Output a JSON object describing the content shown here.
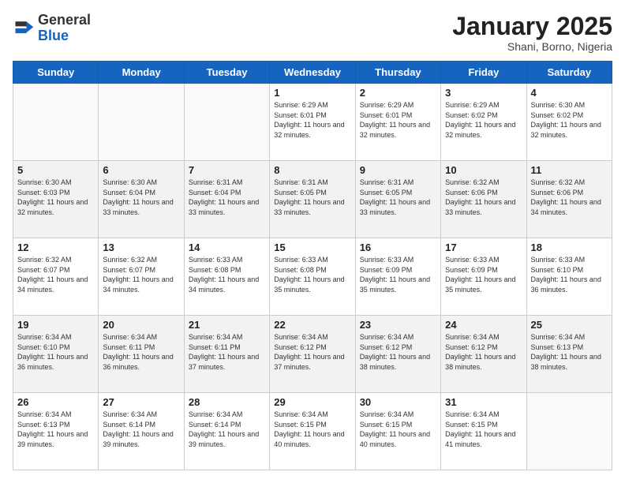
{
  "header": {
    "logo_general": "General",
    "logo_blue": "Blue",
    "month_title": "January 2025",
    "location": "Shani, Borno, Nigeria"
  },
  "days_of_week": [
    "Sunday",
    "Monday",
    "Tuesday",
    "Wednesday",
    "Thursday",
    "Friday",
    "Saturday"
  ],
  "weeks": [
    [
      {
        "day": "",
        "info": ""
      },
      {
        "day": "",
        "info": ""
      },
      {
        "day": "",
        "info": ""
      },
      {
        "day": "1",
        "info": "Sunrise: 6:29 AM\nSunset: 6:01 PM\nDaylight: 11 hours and 32 minutes."
      },
      {
        "day": "2",
        "info": "Sunrise: 6:29 AM\nSunset: 6:01 PM\nDaylight: 11 hours and 32 minutes."
      },
      {
        "day": "3",
        "info": "Sunrise: 6:29 AM\nSunset: 6:02 PM\nDaylight: 11 hours and 32 minutes."
      },
      {
        "day": "4",
        "info": "Sunrise: 6:30 AM\nSunset: 6:02 PM\nDaylight: 11 hours and 32 minutes."
      }
    ],
    [
      {
        "day": "5",
        "info": "Sunrise: 6:30 AM\nSunset: 6:03 PM\nDaylight: 11 hours and 32 minutes."
      },
      {
        "day": "6",
        "info": "Sunrise: 6:30 AM\nSunset: 6:04 PM\nDaylight: 11 hours and 33 minutes."
      },
      {
        "day": "7",
        "info": "Sunrise: 6:31 AM\nSunset: 6:04 PM\nDaylight: 11 hours and 33 minutes."
      },
      {
        "day": "8",
        "info": "Sunrise: 6:31 AM\nSunset: 6:05 PM\nDaylight: 11 hours and 33 minutes."
      },
      {
        "day": "9",
        "info": "Sunrise: 6:31 AM\nSunset: 6:05 PM\nDaylight: 11 hours and 33 minutes."
      },
      {
        "day": "10",
        "info": "Sunrise: 6:32 AM\nSunset: 6:06 PM\nDaylight: 11 hours and 33 minutes."
      },
      {
        "day": "11",
        "info": "Sunrise: 6:32 AM\nSunset: 6:06 PM\nDaylight: 11 hours and 34 minutes."
      }
    ],
    [
      {
        "day": "12",
        "info": "Sunrise: 6:32 AM\nSunset: 6:07 PM\nDaylight: 11 hours and 34 minutes."
      },
      {
        "day": "13",
        "info": "Sunrise: 6:32 AM\nSunset: 6:07 PM\nDaylight: 11 hours and 34 minutes."
      },
      {
        "day": "14",
        "info": "Sunrise: 6:33 AM\nSunset: 6:08 PM\nDaylight: 11 hours and 34 minutes."
      },
      {
        "day": "15",
        "info": "Sunrise: 6:33 AM\nSunset: 6:08 PM\nDaylight: 11 hours and 35 minutes."
      },
      {
        "day": "16",
        "info": "Sunrise: 6:33 AM\nSunset: 6:09 PM\nDaylight: 11 hours and 35 minutes."
      },
      {
        "day": "17",
        "info": "Sunrise: 6:33 AM\nSunset: 6:09 PM\nDaylight: 11 hours and 35 minutes."
      },
      {
        "day": "18",
        "info": "Sunrise: 6:33 AM\nSunset: 6:10 PM\nDaylight: 11 hours and 36 minutes."
      }
    ],
    [
      {
        "day": "19",
        "info": "Sunrise: 6:34 AM\nSunset: 6:10 PM\nDaylight: 11 hours and 36 minutes."
      },
      {
        "day": "20",
        "info": "Sunrise: 6:34 AM\nSunset: 6:11 PM\nDaylight: 11 hours and 36 minutes."
      },
      {
        "day": "21",
        "info": "Sunrise: 6:34 AM\nSunset: 6:11 PM\nDaylight: 11 hours and 37 minutes."
      },
      {
        "day": "22",
        "info": "Sunrise: 6:34 AM\nSunset: 6:12 PM\nDaylight: 11 hours and 37 minutes."
      },
      {
        "day": "23",
        "info": "Sunrise: 6:34 AM\nSunset: 6:12 PM\nDaylight: 11 hours and 38 minutes."
      },
      {
        "day": "24",
        "info": "Sunrise: 6:34 AM\nSunset: 6:12 PM\nDaylight: 11 hours and 38 minutes."
      },
      {
        "day": "25",
        "info": "Sunrise: 6:34 AM\nSunset: 6:13 PM\nDaylight: 11 hours and 38 minutes."
      }
    ],
    [
      {
        "day": "26",
        "info": "Sunrise: 6:34 AM\nSunset: 6:13 PM\nDaylight: 11 hours and 39 minutes."
      },
      {
        "day": "27",
        "info": "Sunrise: 6:34 AM\nSunset: 6:14 PM\nDaylight: 11 hours and 39 minutes."
      },
      {
        "day": "28",
        "info": "Sunrise: 6:34 AM\nSunset: 6:14 PM\nDaylight: 11 hours and 39 minutes."
      },
      {
        "day": "29",
        "info": "Sunrise: 6:34 AM\nSunset: 6:15 PM\nDaylight: 11 hours and 40 minutes."
      },
      {
        "day": "30",
        "info": "Sunrise: 6:34 AM\nSunset: 6:15 PM\nDaylight: 11 hours and 40 minutes."
      },
      {
        "day": "31",
        "info": "Sunrise: 6:34 AM\nSunset: 6:15 PM\nDaylight: 11 hours and 41 minutes."
      },
      {
        "day": "",
        "info": ""
      }
    ]
  ]
}
